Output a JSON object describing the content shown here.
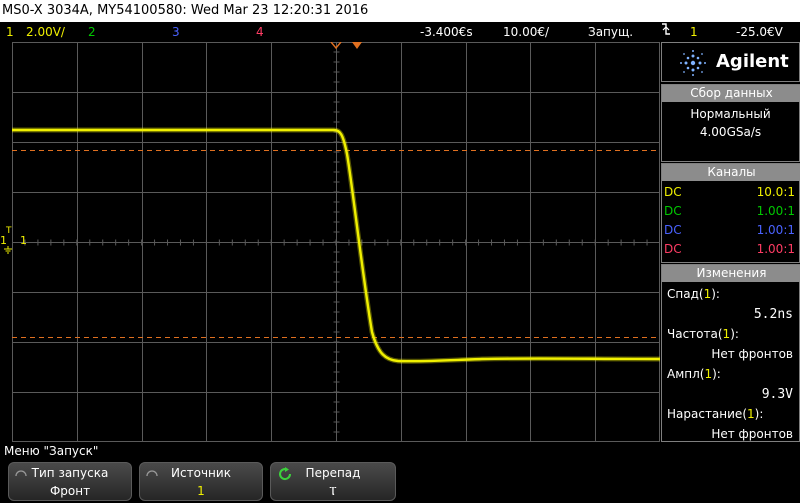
{
  "title": "MS0-X 3034A, MY54100580: Wed Mar 23 12:20:31 2016",
  "status": {
    "ch1": {
      "num": "1",
      "scale": "2.00V/",
      "color": "#f0f000"
    },
    "ch2": {
      "num": "2",
      "color": "#00c800"
    },
    "ch3": {
      "num": "3",
      "color": "#4a62ff"
    },
    "ch4": {
      "num": "4",
      "color": "#ff3c64"
    },
    "time_offset": "-3.400€s",
    "time_scale": "10.00€/",
    "run_state": "Запущ.",
    "trigger_icon": "trigger-edge-icon",
    "trigger_ch": "1",
    "trigger_level": "-25.0€V"
  },
  "plot": {
    "ch1_marker": "1",
    "trigger_marker": "T",
    "cursor_color": "#e07020",
    "trace_color": "#f0f000",
    "grid_color": "#5a5a5a"
  },
  "panel": {
    "logo": "Agilent",
    "acquire": {
      "header": "Сбор данных",
      "mode": "Нормальный",
      "rate": "4.00GSa/s"
    },
    "channels": {
      "header": "Каналы",
      "rows": [
        {
          "coupling": "DC",
          "ratio": "10.0:1",
          "color": "#f0f000"
        },
        {
          "coupling": "DC",
          "ratio": "1.00:1",
          "color": "#00c800"
        },
        {
          "coupling": "DC",
          "ratio": "1.00:1",
          "color": "#4a62ff"
        },
        {
          "coupling": "DC",
          "ratio": "1.00:1",
          "color": "#ff3c64"
        }
      ]
    },
    "measurements": {
      "header": "Изменения",
      "items": [
        {
          "name": "Спад(",
          "ch": "1",
          "suffix": "):",
          "value": "5.2ns"
        },
        {
          "name": "Частота(",
          "ch": "1",
          "suffix": "):",
          "value": "Нет фронтов"
        },
        {
          "name": "Ампл(",
          "ch": "1",
          "suffix": "):",
          "value": "9.3V"
        },
        {
          "name": "Нарастание(",
          "ch": "1",
          "suffix": "):",
          "value": "Нет фронтов"
        }
      ]
    }
  },
  "menu": {
    "title": "Меню \"Запуск\"",
    "softkeys": [
      {
        "label": "Тип запуска",
        "value": "Фронт",
        "value_color": "#ffffff"
      },
      {
        "label": "Источник",
        "value": "1",
        "value_color": "#f0f000"
      },
      {
        "label": "Перепад",
        "value": "Ⲧ",
        "value_color": "#ffffff"
      }
    ]
  }
}
